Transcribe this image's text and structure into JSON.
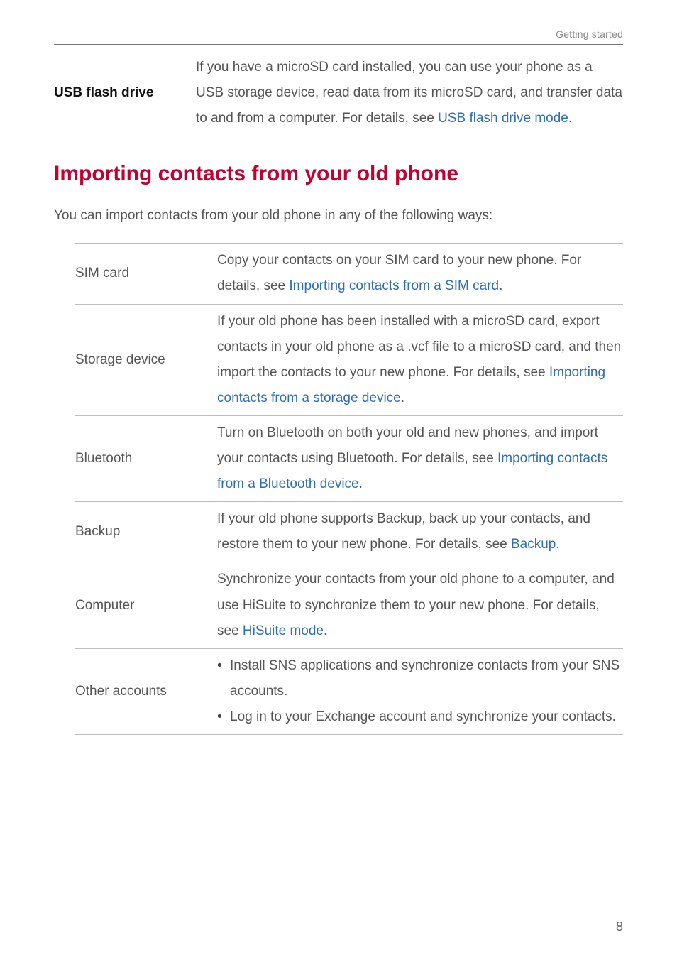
{
  "colors": {
    "accent": "#c3002f",
    "link": "#2e6eb5"
  },
  "running_head": "Getting started",
  "page_number": "8",
  "usb_row": {
    "label": "USB flash drive",
    "desc_before": "If you have a microSD card installed, you can use your phone as a USB storage device, read data from its microSD card, and transfer data to and from a computer. For details, see ",
    "link": "USB flash drive mode",
    "desc_after": "."
  },
  "section": {
    "title": "Importing contacts from your old phone",
    "intro": "You can import contacts from your old phone in any of the following ways:"
  },
  "rows": [
    {
      "label": "SIM card",
      "before": "Copy your contacts on your SIM card to your new phone. For details, see ",
      "link": "Importing contacts from a SIM card",
      "after": "."
    },
    {
      "label": "Storage device",
      "before": "If your old phone has been installed with a microSD card, export contacts in your old phone as a .vcf file to a microSD card, and then import the contacts to your new phone. For details, see ",
      "link": "Importing contacts from a storage device",
      "after": "."
    },
    {
      "label": "Bluetooth",
      "before": "Turn on Bluetooth on both your old and new phones, and import your contacts using Bluetooth. For details, see ",
      "link": "Importing contacts from a Bluetooth device",
      "after": "."
    },
    {
      "label": "Backup",
      "before": "If your old phone supports Backup, back up your contacts, and restore them to your new phone. For details, see ",
      "link": "Backup",
      "after": "."
    },
    {
      "label": "Computer",
      "before": "Synchronize your contacts from your old phone to a computer, and use HiSuite to synchronize them to your new phone. For details, see ",
      "link": "HiSuite mode",
      "after": "."
    }
  ],
  "other_row": {
    "label": "Other accounts",
    "bullet1": "Install SNS applications and synchronize contacts from your SNS accounts.",
    "bullet2": "Log in to your Exchange account and synchronize your contacts."
  }
}
